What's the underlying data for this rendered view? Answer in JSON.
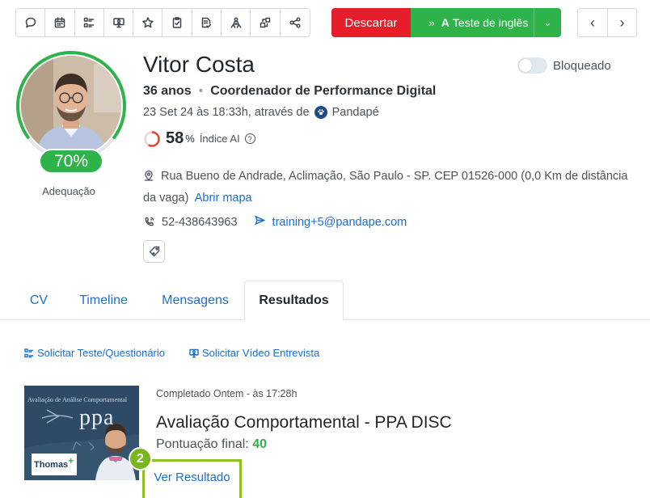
{
  "toolbar": {
    "icons": [
      "chat-icon",
      "calendar-icon",
      "checklist-icon",
      "video-interview-icon",
      "star-icon",
      "clipboard-check-icon",
      "document-check-icon",
      "network-icon",
      "transfer-icon",
      "share-icon"
    ],
    "discard_label": "Descartar",
    "advance_prefix": "A",
    "advance_label": "Teste de inglês"
  },
  "candidate": {
    "name": "Vitor Costa",
    "age": "36 anos",
    "role": "Coordenador de Performance Digital",
    "applied": "23 Set 24 às 18:33h, através de",
    "source": "Pandapé",
    "ai_score": "58",
    "ai_pct": "%",
    "ai_label": "Índice AI",
    "ai_fraction": 0.58,
    "match_score": "70%",
    "match_fraction": 0.7,
    "match_label": "Adequação",
    "blocked_label": "Bloqueado",
    "blocked": false,
    "address": "Rua Bueno de Andrade, Aclimação, São Paulo - SP. CEP 01526-000 (0,0 Km de distância da vaga)",
    "map_link": "Abrir mapa",
    "phone": "52-438643963",
    "email": "training+5@pandape.com"
  },
  "colors": {
    "accent_green": "#2eb34a",
    "danger_red": "#e61d2b",
    "link_blue": "#1a6fd1",
    "highlight_green": "#8dc21f"
  },
  "tabs": [
    {
      "label": "CV",
      "active": false
    },
    {
      "label": "Timeline",
      "active": false
    },
    {
      "label": "Mensagens",
      "active": false
    },
    {
      "label": "Resultados",
      "active": true
    }
  ],
  "actions": {
    "request_test": "Solicitar Teste/Questionário",
    "request_video": "Solicitar Vídeo Entrevista"
  },
  "result": {
    "thumb_title": "Avaliação de Análise Comportamental",
    "thumb_brand": "ppa",
    "thumb_logo": "Thomas",
    "thumb_logo_mark": "+",
    "completed": "Completado Ontem - às 17:28h",
    "title": "Avaliação Comportamental - PPA DISC",
    "final_label": "Pontuação final:",
    "final_value": "40",
    "view_label": "Ver Resultado",
    "step_number": "2"
  }
}
